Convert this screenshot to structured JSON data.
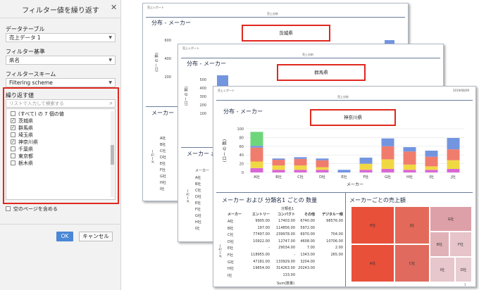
{
  "dialog": {
    "title": "フィルター値を繰り返す",
    "data_table_label": "データテーブル",
    "data_table_value": "売上データ 1",
    "filter_basis_label": "フィルター基準",
    "filter_basis_value": "県名",
    "filter_scheme_label": "フィルタースキーム",
    "filter_scheme_value": "Filtering scheme",
    "repeat_values_label": "繰り返す値",
    "search_placeholder": "リストで入力して検索する",
    "items": [
      {
        "label": "(すべて) の 7 個の値",
        "checked": false
      },
      {
        "label": "茨城県",
        "checked": true
      },
      {
        "label": "群馬県",
        "checked": true
      },
      {
        "label": "埼玉県",
        "checked": false
      },
      {
        "label": "神奈川県",
        "checked": true
      },
      {
        "label": "千葉県",
        "checked": false
      },
      {
        "label": "東京都",
        "checked": false
      },
      {
        "label": "栃木県",
        "checked": false
      }
    ],
    "include_empty_label": "空のページを含める",
    "ok_label": "OK",
    "cancel_label": "キャンセル"
  },
  "pages": [
    {
      "prefecture": "茨城県",
      "report_header": "売上分析",
      "corner_left": "売上レポート",
      "dist_title": "分布 - メーカー",
      "y_label": "(ロー の 数)",
      "ticks": [
        "600",
        "400",
        "200"
      ],
      "maker_title": "メーカー",
      "maker_axis": "メーカー",
      "rows": [
        "A社",
        "B社",
        "C社",
        "D社",
        "E社",
        "F社",
        "G社",
        "H社",
        "I社"
      ]
    },
    {
      "prefecture": "群馬県",
      "report_header": "売上分析",
      "corner_left": "売上レポート",
      "dist_title": "分布 - メーカー",
      "y_label": "(ロー の 数)",
      "ticks": [
        "500",
        "400",
        "300",
        "200",
        "100"
      ],
      "maker_title": "メーカー お",
      "maker_axis": "メーカー",
      "maker_header": "メーカー",
      "rows": [
        "A社",
        "B社",
        "C社",
        "D社",
        "E社",
        "F社",
        "G社",
        "H社",
        "I社"
      ]
    },
    {
      "prefecture": "神奈川県",
      "report_header": "売上分析",
      "corner_left": "売上レポート",
      "corner_right": "2019/08/09",
      "dist_title": "分布 - メーカー",
      "table_title": "メーカー および 分類名1 ごとの 数量",
      "treemap_title": "メーカーごとの売上額",
      "page_number": "1"
    }
  ],
  "chart_data": {
    "type": "bar",
    "stacked": true,
    "title": "分布 - メーカー",
    "xlabel": "メーカー",
    "ylabel": "(ロー の 数)",
    "ylim": [
      0,
      100
    ],
    "y_ticks": [
      "100",
      "80",
      "60",
      "40",
      "20",
      "0"
    ],
    "categories": [
      "A社",
      "B社",
      "C社",
      "D社",
      "E社",
      "F社",
      "G社",
      "H社",
      "I社",
      "J社"
    ],
    "segment_colors": [
      "#d966d6",
      "#f0d843",
      "#f07c6e",
      "#7395e0",
      "#6ed67a"
    ],
    "series": [
      {
        "values": [
          10,
          6,
          6,
          6,
          0,
          6,
          8,
          6,
          6,
          8
        ]
      },
      {
        "values": [
          15,
          10,
          10,
          6,
          0,
          14,
          22,
          12,
          8,
          20
        ]
      },
      {
        "values": [
          32,
          13,
          15,
          16,
          0,
          0,
          30,
          30,
          22,
          25
        ]
      },
      {
        "values": [
          4,
          3,
          4,
          4,
          6,
          14,
          18,
          10,
          14,
          26
        ]
      },
      {
        "values": [
          32,
          0,
          0,
          0,
          0,
          0,
          0,
          0,
          0,
          0
        ]
      }
    ]
  },
  "table": {
    "header_group": "分類名1",
    "columns": [
      "メーカー",
      "エントリー",
      "コンパクト",
      "その他",
      "デジタル一眼"
    ],
    "rows": [
      [
        "A社",
        "9905.00",
        "17403.00",
        "6740.00",
        "98576.00"
      ],
      [
        "B社",
        "197.00",
        "114856.00",
        "5972.00",
        ""
      ],
      [
        "C社",
        "77497.00",
        "239978.00",
        "6970.00",
        "704.00"
      ],
      [
        "D社",
        "10922.00",
        "12747.00",
        "4608.00",
        "10706.00"
      ],
      [
        "E社",
        "-",
        "29034.00",
        "7.00",
        "2.00"
      ],
      [
        "F社",
        "118955.00",
        "-",
        "1343.00",
        "265.00"
      ],
      [
        "G社",
        "47181.00",
        "133929.00",
        "3204.00",
        ""
      ],
      [
        "H社",
        "19654.00",
        "314263.00",
        "20243.00",
        ""
      ],
      [
        "I社",
        "",
        "133.00",
        "",
        ""
      ]
    ],
    "footer": "Sum(数量)",
    "row_axis_label": "メーカー"
  },
  "treemap": {
    "cells": [
      {
        "label": "H社",
        "color": "#e8503a"
      },
      {
        "label": "J社",
        "color": "#e36a5a"
      },
      {
        "label": "A社",
        "color": "#e8503a"
      },
      {
        "label": "C社",
        "color": "#e06a5e"
      },
      {
        "label": "G社",
        "color": "#dea0a8"
      },
      {
        "label": "B社",
        "color": "#e0b2b8"
      },
      {
        "label": "F社",
        "color": "#e6c4ca"
      },
      {
        "label": "I社",
        "color": "#e7c6cc"
      },
      {
        "label": "D社",
        "color": "#e8cdd2"
      }
    ]
  }
}
